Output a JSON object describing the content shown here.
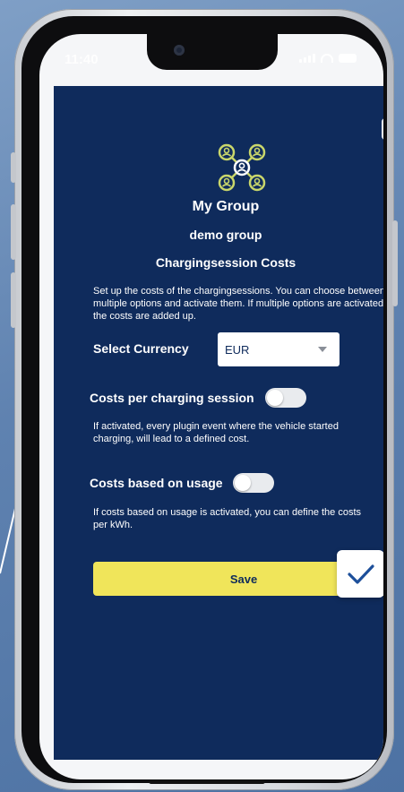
{
  "status_bar": {
    "time": "11:40"
  },
  "dialog": {
    "group_name": "My Group",
    "subgroup_name": "demo group",
    "section_title": "Chargingsession Costs",
    "intro_text": "Set up the costs of the chargingsessions. You can choose between multiple options and activate them. If multiple options are activated, the costs are added up.",
    "currency": {
      "label": "Select Currency",
      "selected": "EUR"
    },
    "per_session": {
      "label": "Costs per charging session",
      "enabled": false,
      "help": "If activated, every plugin event where the vehicle started charging, will lead to a defined cost."
    },
    "usage_based": {
      "label": "Costs based on usage",
      "enabled": false,
      "help": "If costs based on usage is activated, you can define the costs per kWh."
    },
    "save_label": "Save"
  },
  "icons": {
    "close": "close-icon",
    "group": "group-network-icon",
    "checkmark": "checkmark-icon",
    "dropdown": "chevron-down-icon"
  },
  "colors": {
    "panel_bg": "#0f2b5c",
    "save_bg": "#f0e55a",
    "icon_accent": "#c9d66b"
  }
}
